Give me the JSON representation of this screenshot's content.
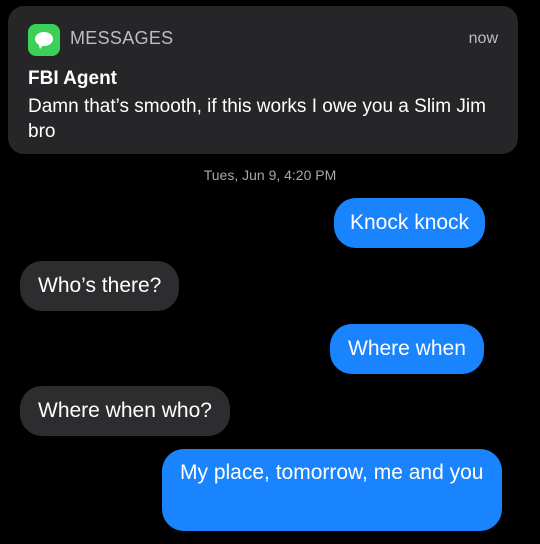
{
  "notification": {
    "app_name": "MESSAGES",
    "time": "now",
    "sender": "FBI Agent",
    "body": "Damn that’s smooth, if this works I owe you a Slim Jim bro",
    "icon": "messages-app-icon"
  },
  "conversation": {
    "timestamp": "Tues, Jun 9, 4:20 PM",
    "messages": [
      {
        "side": "sent",
        "text": "Knock knock"
      },
      {
        "side": "received",
        "text": "Who’s there?"
      },
      {
        "side": "sent",
        "text": "Where when"
      },
      {
        "side": "received",
        "text": "Where when who?"
      },
      {
        "side": "sent",
        "text": "My place, tomorrow, me and you"
      }
    ]
  },
  "colors": {
    "sent_bubble": "#1a84ff",
    "received_bubble": "#2d2d30",
    "notification_bg": "#262628",
    "app_icon": "#3bd158"
  }
}
